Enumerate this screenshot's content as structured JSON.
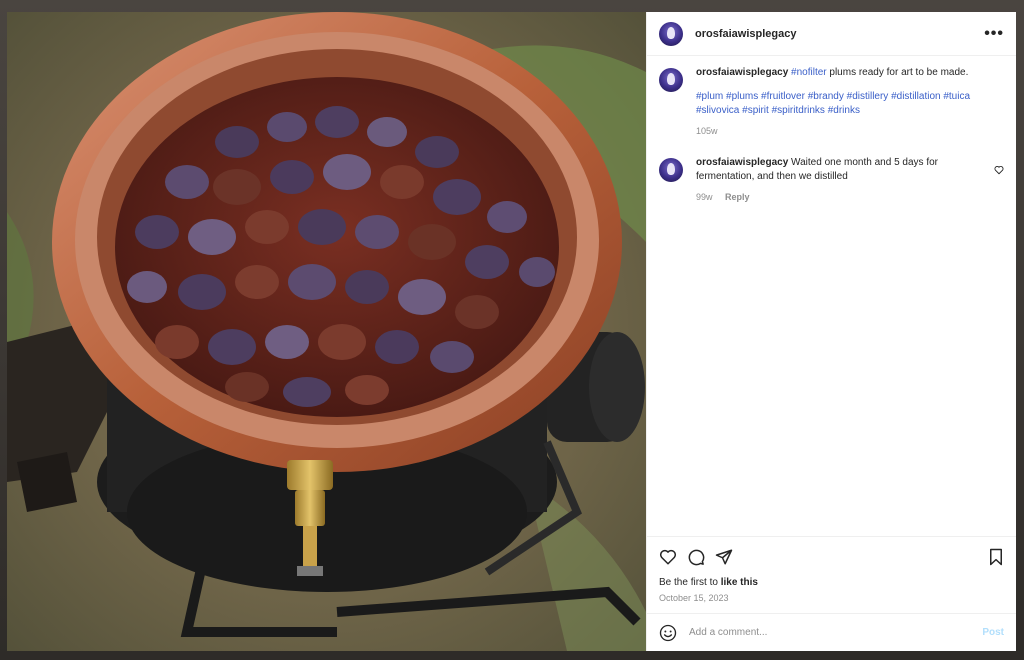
{
  "post": {
    "username": "orosfaiawisplegacy",
    "more_icon": "more-horizontal-icon",
    "image_alt": "Copper pot with fermented plums on a black stove"
  },
  "caption": {
    "username": "orosfaiawisplegacy",
    "hashtag_lead": "#nofilter",
    "text": " plums ready for art to be made.",
    "hashtags": "#plum #plums #fruitlover #brandy #distillery #distillation #tuica #slivovica #spirit #spiritdrinks #drinks",
    "age": "105w"
  },
  "comments": [
    {
      "username": "orosfaiawisplegacy",
      "text": " Waited one month and 5 days for fermentation, and then we distilled",
      "age": "99w",
      "reply_label": "Reply"
    }
  ],
  "actions": {
    "like_icon": "heart-icon",
    "comment_icon": "comment-icon",
    "share_icon": "share-icon",
    "save_icon": "bookmark-icon"
  },
  "likes": {
    "prefix": "Be the first to ",
    "link": "like this"
  },
  "date": "October 15, 2023",
  "add_comment": {
    "placeholder": "Add a comment...",
    "post_label": "Post",
    "emoji_icon": "emoji-icon"
  },
  "colors": {
    "link_blue": "#3a5fc8",
    "post_disabled": "#b2dffc",
    "copper": "#b8613a"
  }
}
